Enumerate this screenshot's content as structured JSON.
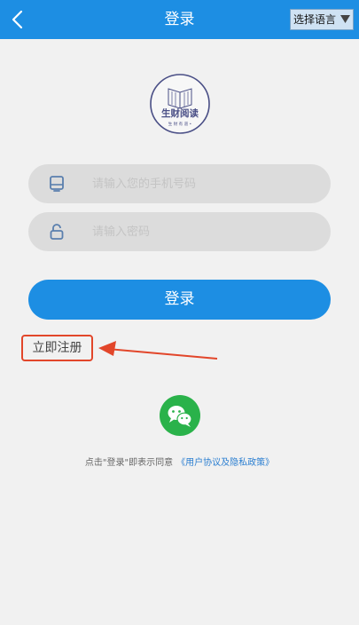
{
  "header": {
    "title": "登录",
    "language_button": "选择语言",
    "back_icon": "chevron-left-icon",
    "background_color": "#1d8ee3"
  },
  "logo": {
    "text": "生财阅读",
    "subtext": "生 财 有 道 •",
    "color": "#4a4f86"
  },
  "form": {
    "phone": {
      "icon": "phone-icon",
      "placeholder": "请输入您的手机号码",
      "value": ""
    },
    "password": {
      "icon": "lock-icon",
      "placeholder": "请输入密码",
      "value": ""
    },
    "login_button": "登录"
  },
  "register_link": "立即注册",
  "highlight_color": "#e2462a",
  "wechat": {
    "icon": "wechat-icon",
    "color": "#2ab24a"
  },
  "agreement": {
    "prefix": "点击\"登录\"即表示同意",
    "policy_link": "《用户协议及隐私政策》"
  }
}
